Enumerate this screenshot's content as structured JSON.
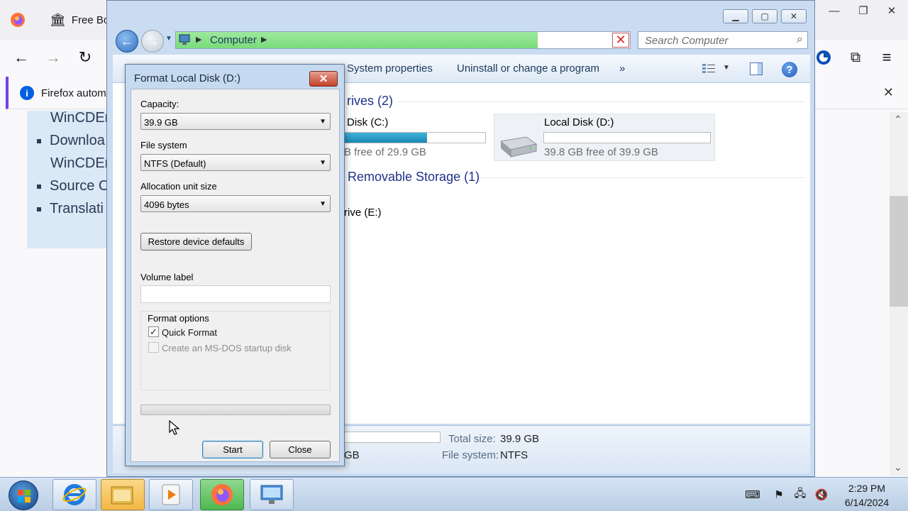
{
  "firefox": {
    "tab_title": "Free Boo",
    "infobar_text": "Firefox automa",
    "list_items": [
      "WinCDEr",
      "Downloa",
      "WinCDEr",
      "Source C",
      "Translati"
    ]
  },
  "explorer": {
    "address_path": "Computer",
    "search_placeholder": "Search Computer",
    "commands": [
      "System properties",
      "Uninstall or change a program"
    ],
    "more_chevron": "»",
    "groups": [
      {
        "title": "rives (2)"
      },
      {
        "title": "Removable Storage (1)"
      }
    ],
    "drives": [
      {
        "name": "Disk (C:)",
        "free_text": "B free of 29.9 GB",
        "used_fraction": 0.6
      },
      {
        "name": "Local Disk (D:)",
        "free_text": "39.8 GB free of 39.9 GB",
        "used_fraction": 0.0
      },
      {
        "name": "rive (E:)"
      }
    ],
    "details": {
      "space_partial": "GB",
      "total_size_label": "Total size:",
      "total_size_value": "39.9 GB",
      "file_system_label": "File system:",
      "file_system_value": "NTFS"
    }
  },
  "dialog": {
    "title": "Format Local Disk (D:)",
    "capacity_label": "Capacity:",
    "capacity_value": "39.9 GB",
    "filesystem_label": "File system",
    "filesystem_value": "NTFS (Default)",
    "allocation_label": "Allocation unit size",
    "allocation_value": "4096 bytes",
    "restore_button": "Restore device defaults",
    "volume_label": "Volume label",
    "volume_value": "",
    "format_options_label": "Format options",
    "quick_format_label": "Quick Format",
    "quick_format_checked": true,
    "msdos_label": "Create an MS-DOS startup disk",
    "msdos_checked": false,
    "progress": 0,
    "start_button": "Start",
    "close_button": "Close"
  },
  "taskbar": {
    "time": "2:29 PM",
    "date": "6/14/2024"
  }
}
